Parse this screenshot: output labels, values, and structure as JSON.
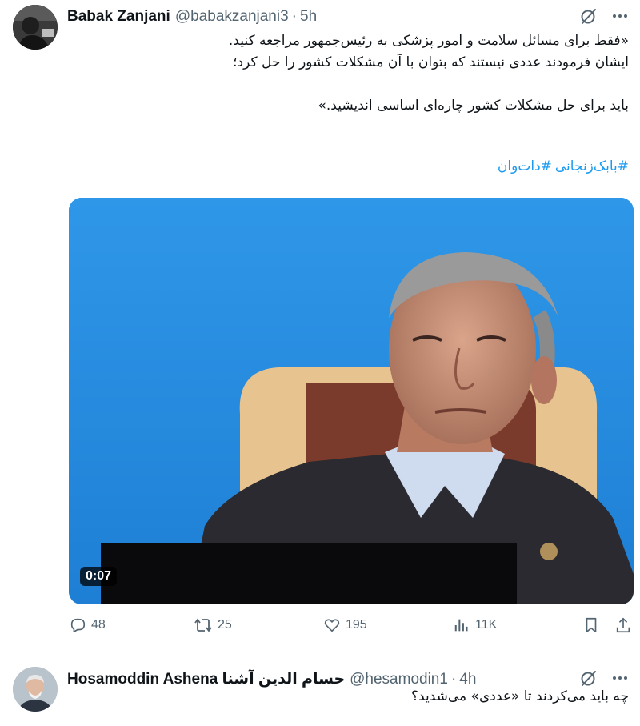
{
  "tweet1": {
    "author": {
      "name": "Babak Zanjani",
      "handle": "@babakzanjani3",
      "time": "5h"
    },
    "body_lines": [
      "«فقط برای مسائل سلامت و امور پزشکی به رئیس‌جمهور مراجعه کنید.",
      "ایشان فرمودند عددی نیستند که بتوان با آن مشکلات کشور را حل کرد؛",
      "",
      "باید برای حل مشکلات کشور چاره‌ای اساسی اندیشید.»"
    ],
    "hashtags": [
      "#بابک‌زنجانی",
      "#دات‌وان"
    ],
    "media": {
      "duration": "0:07"
    },
    "stats": {
      "replies": "48",
      "reposts": "25",
      "likes": "195",
      "views": "11K"
    }
  },
  "tweet2": {
    "author": {
      "name": "Hosamoddin Ashena حسام الدین آشنا",
      "handle": "@hesamodin1",
      "time": "4h"
    },
    "body_lines": [
      "چه باید می‌کردند تا «عددی» می‌شدید؟"
    ]
  },
  "icons": {
    "grok": "grok-icon",
    "more": "more-icon",
    "reply": "reply-icon",
    "repost": "repost-icon",
    "like": "like-icon",
    "views": "views-icon",
    "bookmark": "bookmark-icon",
    "share": "share-icon"
  },
  "colors": {
    "link": "#1d9bf0",
    "muted": "#536471",
    "media_bg": "#2a8fe0"
  }
}
